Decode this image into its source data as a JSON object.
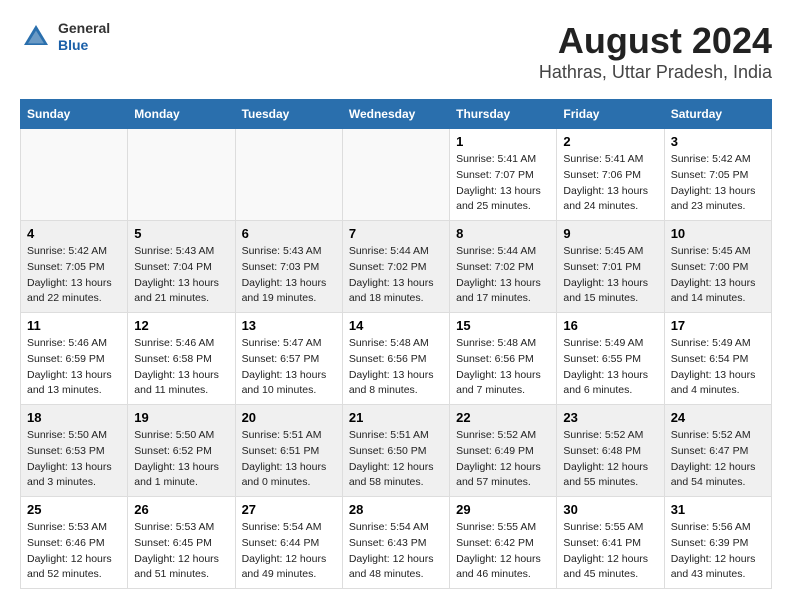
{
  "header": {
    "logo_general": "General",
    "logo_blue": "Blue",
    "title": "August 2024",
    "subtitle": "Hathras, Uttar Pradesh, India"
  },
  "weekdays": [
    "Sunday",
    "Monday",
    "Tuesday",
    "Wednesday",
    "Thursday",
    "Friday",
    "Saturday"
  ],
  "weeks": [
    [
      {
        "day": "",
        "info": ""
      },
      {
        "day": "",
        "info": ""
      },
      {
        "day": "",
        "info": ""
      },
      {
        "day": "",
        "info": ""
      },
      {
        "day": "1",
        "info": "Sunrise: 5:41 AM\nSunset: 7:07 PM\nDaylight: 13 hours\nand 25 minutes."
      },
      {
        "day": "2",
        "info": "Sunrise: 5:41 AM\nSunset: 7:06 PM\nDaylight: 13 hours\nand 24 minutes."
      },
      {
        "day": "3",
        "info": "Sunrise: 5:42 AM\nSunset: 7:05 PM\nDaylight: 13 hours\nand 23 minutes."
      }
    ],
    [
      {
        "day": "4",
        "info": "Sunrise: 5:42 AM\nSunset: 7:05 PM\nDaylight: 13 hours\nand 22 minutes."
      },
      {
        "day": "5",
        "info": "Sunrise: 5:43 AM\nSunset: 7:04 PM\nDaylight: 13 hours\nand 21 minutes."
      },
      {
        "day": "6",
        "info": "Sunrise: 5:43 AM\nSunset: 7:03 PM\nDaylight: 13 hours\nand 19 minutes."
      },
      {
        "day": "7",
        "info": "Sunrise: 5:44 AM\nSunset: 7:02 PM\nDaylight: 13 hours\nand 18 minutes."
      },
      {
        "day": "8",
        "info": "Sunrise: 5:44 AM\nSunset: 7:02 PM\nDaylight: 13 hours\nand 17 minutes."
      },
      {
        "day": "9",
        "info": "Sunrise: 5:45 AM\nSunset: 7:01 PM\nDaylight: 13 hours\nand 15 minutes."
      },
      {
        "day": "10",
        "info": "Sunrise: 5:45 AM\nSunset: 7:00 PM\nDaylight: 13 hours\nand 14 minutes."
      }
    ],
    [
      {
        "day": "11",
        "info": "Sunrise: 5:46 AM\nSunset: 6:59 PM\nDaylight: 13 hours\nand 13 minutes."
      },
      {
        "day": "12",
        "info": "Sunrise: 5:46 AM\nSunset: 6:58 PM\nDaylight: 13 hours\nand 11 minutes."
      },
      {
        "day": "13",
        "info": "Sunrise: 5:47 AM\nSunset: 6:57 PM\nDaylight: 13 hours\nand 10 minutes."
      },
      {
        "day": "14",
        "info": "Sunrise: 5:48 AM\nSunset: 6:56 PM\nDaylight: 13 hours\nand 8 minutes."
      },
      {
        "day": "15",
        "info": "Sunrise: 5:48 AM\nSunset: 6:56 PM\nDaylight: 13 hours\nand 7 minutes."
      },
      {
        "day": "16",
        "info": "Sunrise: 5:49 AM\nSunset: 6:55 PM\nDaylight: 13 hours\nand 6 minutes."
      },
      {
        "day": "17",
        "info": "Sunrise: 5:49 AM\nSunset: 6:54 PM\nDaylight: 13 hours\nand 4 minutes."
      }
    ],
    [
      {
        "day": "18",
        "info": "Sunrise: 5:50 AM\nSunset: 6:53 PM\nDaylight: 13 hours\nand 3 minutes."
      },
      {
        "day": "19",
        "info": "Sunrise: 5:50 AM\nSunset: 6:52 PM\nDaylight: 13 hours\nand 1 minute."
      },
      {
        "day": "20",
        "info": "Sunrise: 5:51 AM\nSunset: 6:51 PM\nDaylight: 13 hours\nand 0 minutes."
      },
      {
        "day": "21",
        "info": "Sunrise: 5:51 AM\nSunset: 6:50 PM\nDaylight: 12 hours\nand 58 minutes."
      },
      {
        "day": "22",
        "info": "Sunrise: 5:52 AM\nSunset: 6:49 PM\nDaylight: 12 hours\nand 57 minutes."
      },
      {
        "day": "23",
        "info": "Sunrise: 5:52 AM\nSunset: 6:48 PM\nDaylight: 12 hours\nand 55 minutes."
      },
      {
        "day": "24",
        "info": "Sunrise: 5:52 AM\nSunset: 6:47 PM\nDaylight: 12 hours\nand 54 minutes."
      }
    ],
    [
      {
        "day": "25",
        "info": "Sunrise: 5:53 AM\nSunset: 6:46 PM\nDaylight: 12 hours\nand 52 minutes."
      },
      {
        "day": "26",
        "info": "Sunrise: 5:53 AM\nSunset: 6:45 PM\nDaylight: 12 hours\nand 51 minutes."
      },
      {
        "day": "27",
        "info": "Sunrise: 5:54 AM\nSunset: 6:44 PM\nDaylight: 12 hours\nand 49 minutes."
      },
      {
        "day": "28",
        "info": "Sunrise: 5:54 AM\nSunset: 6:43 PM\nDaylight: 12 hours\nand 48 minutes."
      },
      {
        "day": "29",
        "info": "Sunrise: 5:55 AM\nSunset: 6:42 PM\nDaylight: 12 hours\nand 46 minutes."
      },
      {
        "day": "30",
        "info": "Sunrise: 5:55 AM\nSunset: 6:41 PM\nDaylight: 12 hours\nand 45 minutes."
      },
      {
        "day": "31",
        "info": "Sunrise: 5:56 AM\nSunset: 6:39 PM\nDaylight: 12 hours\nand 43 minutes."
      }
    ]
  ]
}
